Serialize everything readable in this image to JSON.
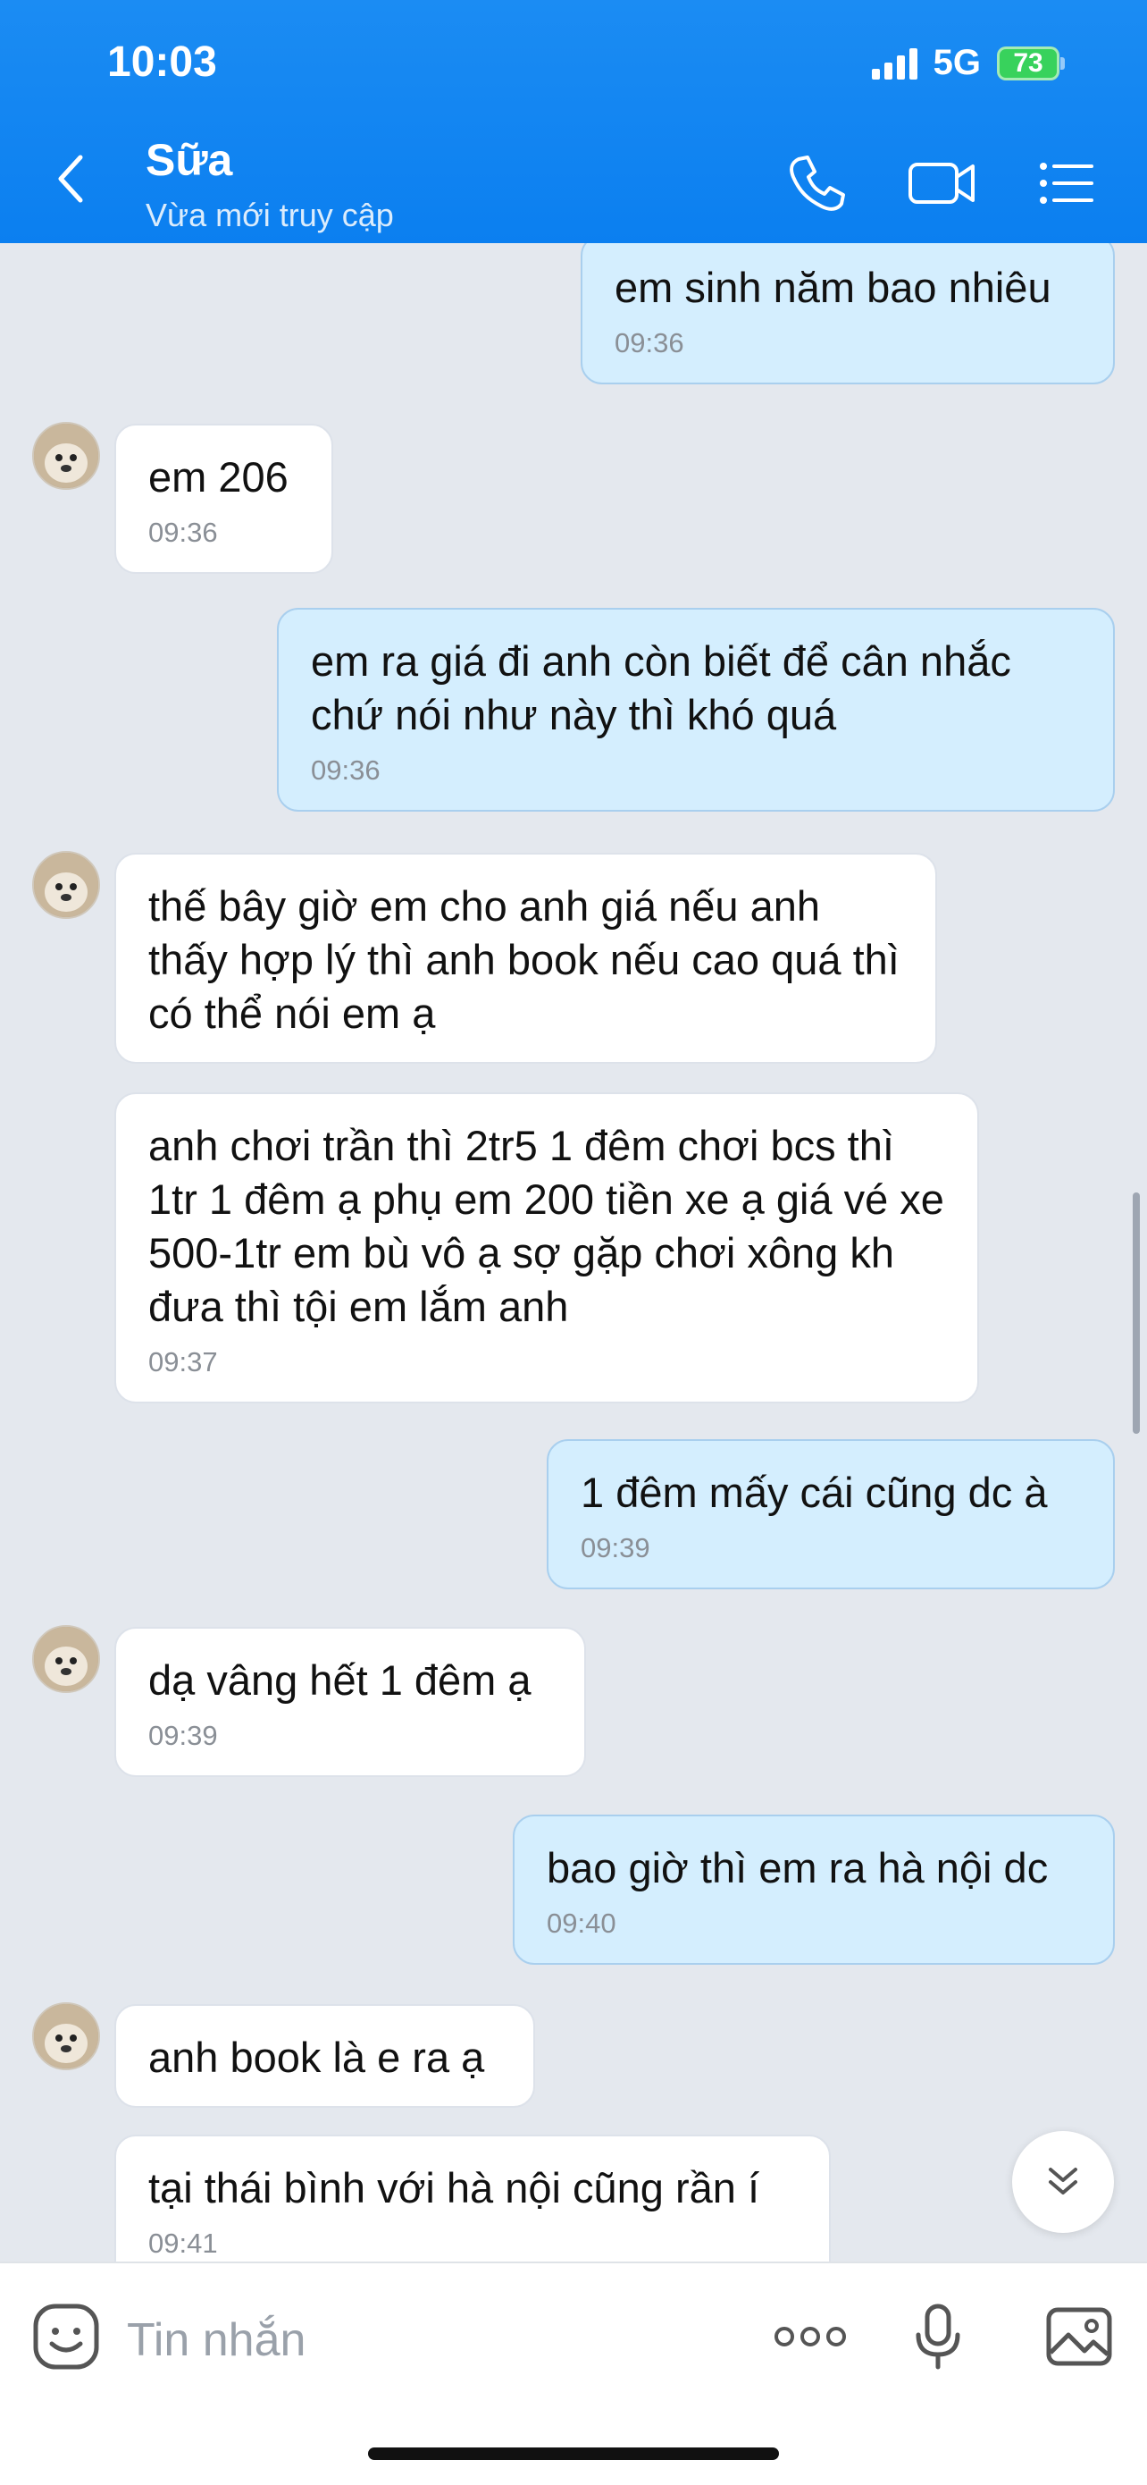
{
  "status_bar": {
    "time": "10:03",
    "network": "5G",
    "battery": "73"
  },
  "header": {
    "title": "Sữa",
    "subtitle": "Vừa mới truy cập"
  },
  "messages": [
    {
      "side": "out",
      "text": "em sinh năm bao nhiêu",
      "time": "09:36"
    },
    {
      "side": "in",
      "text": "em 206",
      "time": "09:36"
    },
    {
      "side": "out",
      "text": "em ra giá đi anh còn biết để cân nhắc chứ nói như này thì khó quá",
      "time": "09:36"
    },
    {
      "side": "in",
      "text": "thế bây giờ em cho anh giá nếu anh thấy hợp lý thì anh book nếu cao quá thì có thể nói em ạ",
      "time": ""
    },
    {
      "side": "in",
      "text": "anh chơi trần thì 2tr5 1 đêm chơi bcs thì 1tr 1 đêm ạ phụ em 200 tiền xe ạ giá vé xe 500-1tr em bù vô ạ sợ gặp chơi xông kh đưa thì tội em lắm anh",
      "time": "09:37"
    },
    {
      "side": "out",
      "text": "1 đêm mấy cái cũng dc à",
      "time": "09:39"
    },
    {
      "side": "in",
      "text": "dạ vâng hết 1 đêm ạ",
      "time": "09:39"
    },
    {
      "side": "out",
      "text": "bao giờ thì em ra hà nội dc",
      "time": "09:40"
    },
    {
      "side": "in",
      "text": "anh book là e ra ạ",
      "time": ""
    },
    {
      "side": "in",
      "text": "tại thái bình với hà nội cũng rần í",
      "time": "09:41"
    }
  ],
  "composer": {
    "placeholder": "Tin nhắn"
  },
  "icons": {
    "back": "chevron-left-icon",
    "call": "phone-icon",
    "video": "video-camera-icon",
    "menu": "list-menu-icon",
    "sticker": "emoji-sticker-icon",
    "more": "more-dots-icon",
    "voice": "microphone-icon",
    "image": "image-icon",
    "scroll": "double-chevron-down-icon"
  },
  "colors": {
    "header": "#0b7ff0",
    "outgoing_bubble": "#d4eefe",
    "incoming_bubble": "#ffffff",
    "background": "#e4e8ee"
  }
}
